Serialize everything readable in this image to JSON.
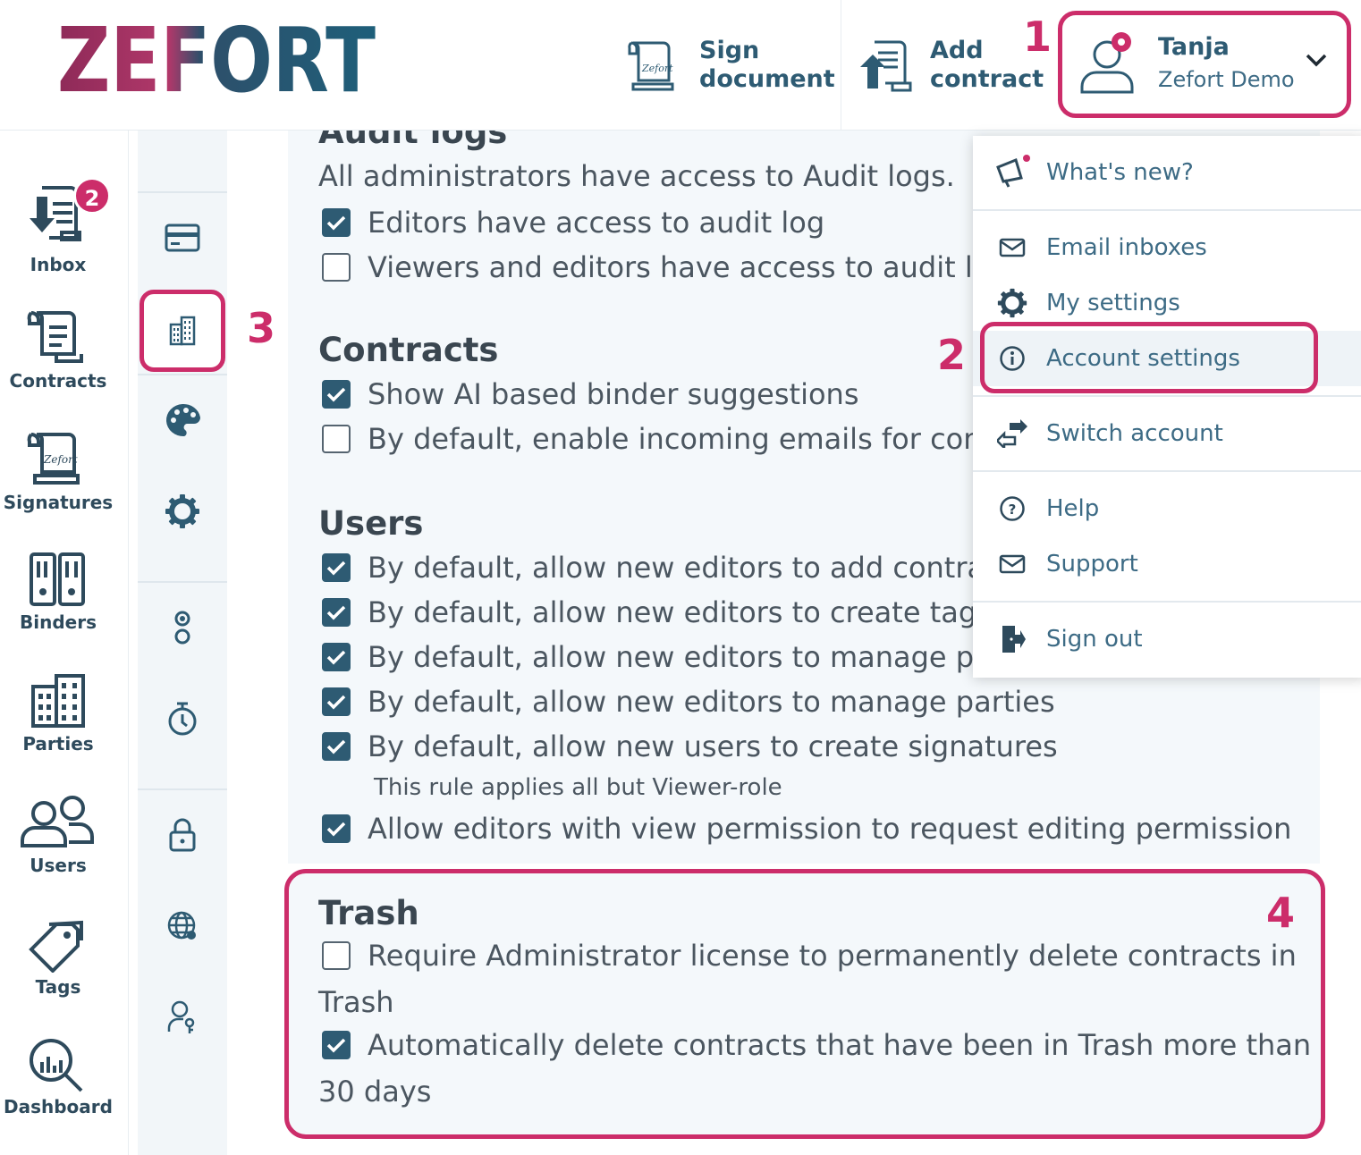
{
  "brand": {
    "logo_text": "ZEFORT",
    "accent": "#cc2d6a",
    "primary": "#2e5b73"
  },
  "header": {
    "sign_document": "Sign\ndocument",
    "add_contract": "Add\ncontract",
    "user": {
      "name": "Tanja",
      "org": "Zefort Demo"
    }
  },
  "steps": {
    "s1": "1",
    "s2": "2",
    "s3": "3",
    "s4": "4"
  },
  "nav": {
    "inbox": {
      "label": "Inbox",
      "badge": "2"
    },
    "contracts": "Contracts",
    "signatures": "Signatures",
    "binders": "Binders",
    "parties": "Parties",
    "users": "Users",
    "tags": "Tags",
    "dashboard": "Dashboard"
  },
  "sub_nav": [
    "billing-icon",
    "company-icon",
    "palette-icon",
    "gear-icon",
    "integrations-icon",
    "timer-icon",
    "lock-icon",
    "globe-icon",
    "user-key-icon"
  ],
  "settings": {
    "audit": {
      "title": "Audit logs",
      "desc": "All administrators have access to Audit logs.",
      "opt1": {
        "label": "Editors have access to audit log",
        "checked": true
      },
      "opt2": {
        "label": "Viewers and editors have access to audit log",
        "checked": false
      }
    },
    "contracts": {
      "title": "Contracts",
      "opt1": {
        "label": "Show AI based binder suggestions",
        "checked": true
      },
      "opt2": {
        "label": "By default, enable incoming emails for contracts",
        "checked": false
      }
    },
    "users": {
      "title": "Users",
      "opt1": {
        "label": "By default, allow new editors to add contracts",
        "checked": true
      },
      "opt2": {
        "label": "By default, allow new editors to create tags",
        "checked": true
      },
      "opt3": {
        "label": "By default, allow new editors to manage parties",
        "checked": true
      },
      "opt4": {
        "label": "By default, allow new editors to manage parties",
        "checked": true
      },
      "opt5": {
        "label": "By default, allow new users to create signatures",
        "checked": true
      },
      "hint": "This rule applies all but Viewer-role",
      "opt6": {
        "label": "Allow editors with view permission to request editing permission",
        "checked": true
      }
    },
    "trash": {
      "title": "Trash",
      "opt1": {
        "label": "Require Administrator license to permanently delete contracts in",
        "label2": "Trash",
        "checked": false
      },
      "opt2": {
        "label": "Automatically delete contracts that have been in Trash more than",
        "label2": "30 days",
        "checked": true
      }
    }
  },
  "dropdown": {
    "whats_new": "What's new?",
    "email_inboxes": "Email inboxes",
    "my_settings": "My settings",
    "account_settings": "Account settings",
    "switch_account": "Switch account",
    "help": "Help",
    "support": "Support",
    "sign_out": "Sign out"
  }
}
